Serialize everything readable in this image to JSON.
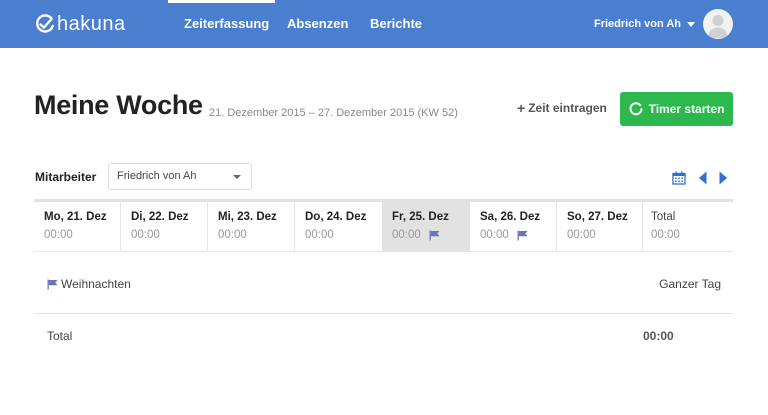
{
  "app": {
    "logo_text": "hakuna"
  },
  "nav": {
    "items": [
      {
        "label": "Zeiterfassung",
        "active": true
      },
      {
        "label": "Absenzen",
        "active": false
      },
      {
        "label": "Berichte",
        "active": false
      }
    ],
    "user_name": "Friedrich von Ah"
  },
  "page": {
    "title": "Meine Woche",
    "date_range": "21. Dezember 2015 – 27. Dezember 2015 (KW 52)",
    "add_time_label": "Zeit eintragen",
    "timer_button_label": "Timer starten"
  },
  "filter": {
    "employee_label": "Mitarbeiter",
    "employee_selected": "Friedrich von Ah"
  },
  "week": {
    "days": [
      {
        "name": "Mo, 21. Dez",
        "time": "00:00",
        "holiday_flag": false
      },
      {
        "name": "Di, 22. Dez",
        "time": "00:00",
        "holiday_flag": false
      },
      {
        "name": "Mi, 23. Dez",
        "time": "00:00",
        "holiday_flag": false
      },
      {
        "name": "Do, 24. Dez",
        "time": "00:00",
        "holiday_flag": false
      },
      {
        "name": "Fr, 25. Dez",
        "time": "00:00",
        "holiday_flag": true
      },
      {
        "name": "Sa, 26. Dez",
        "time": "00:00",
        "holiday_flag": true
      },
      {
        "name": "So, 27. Dez",
        "time": "00:00",
        "holiday_flag": false
      }
    ],
    "total_label": "Total",
    "total_time": "00:00"
  },
  "entries": [
    {
      "name": "Weihnachten",
      "duration": "Ganzer Tag",
      "icon": "flag-icon"
    }
  ],
  "summary": {
    "label": "Total",
    "value": "00:00"
  },
  "colors": {
    "header_bg": "#4a7fd0",
    "timer_green": "#2db84d",
    "holiday_bg": "#e2e2e2",
    "flag_color": "#6a74b8",
    "nav_arrow_blue": "#2f6fd0"
  }
}
